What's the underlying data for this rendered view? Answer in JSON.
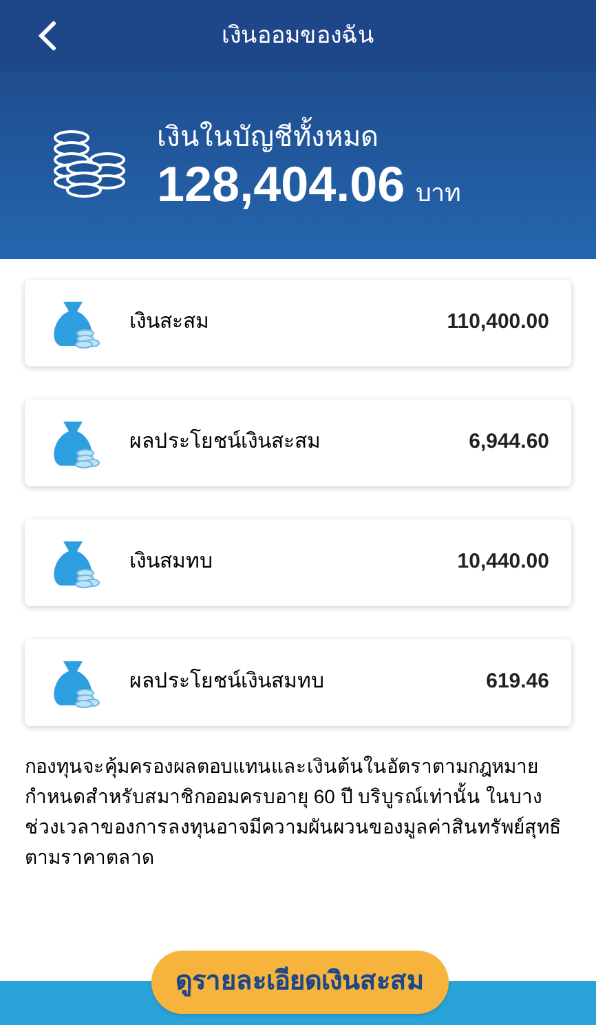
{
  "header": {
    "title": "เงินออมของฉัน"
  },
  "summary": {
    "label": "เงินในบัญชีทั้งหมด",
    "amount": "128,404.06",
    "unit": "บาท"
  },
  "accounts": [
    {
      "name": "เงินสะสม",
      "amount": "110,400.00"
    },
    {
      "name": "ผลประโยชน์เงินสะสม",
      "amount": "6,944.60"
    },
    {
      "name": "เงินสมทบ",
      "amount": "10,440.00"
    },
    {
      "name": "ผลประโยชน์เงินสมทบ",
      "amount": "619.46"
    }
  ],
  "notice": "กองทุนจะคุ้มครองผลตอบแทนและเงินต้นในอัตราตามกฎหมายกำหนดสำหรับสมาชิกออมครบอายุ 60 ปี บริบูรณ์เท่านั้น ในบางช่วงเวลาของการลงทุนอาจมีความผันผวนของมูลค่าสินทรัพย์สุทธิตามราคาตลาด",
  "button": "ดูรายละเอียดเงินสะสม"
}
